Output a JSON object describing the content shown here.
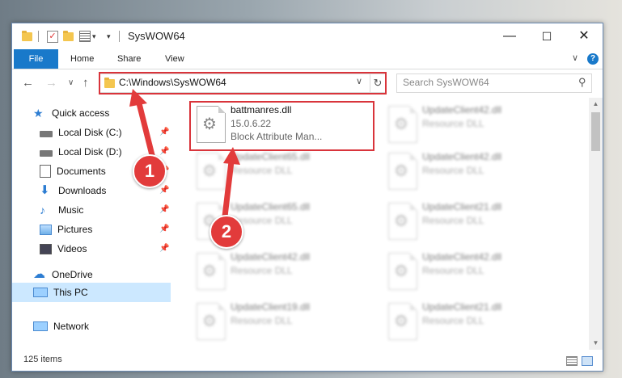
{
  "window": {
    "title": "SysWOW64",
    "minimize_glyph": "—",
    "maximize_glyph": "☐",
    "close_glyph": "✕"
  },
  "ribbon": {
    "tabs": [
      "File",
      "Home",
      "Share",
      "View"
    ],
    "expand_glyph": "∨",
    "help_glyph": "?"
  },
  "nav": {
    "back_glyph": "←",
    "forward_glyph": "→",
    "recent_glyph": "∨",
    "up_glyph": "↑",
    "address": "C:\\Windows\\SysWOW64",
    "address_dropdown_glyph": "∨",
    "refresh_glyph": "↻",
    "search_placeholder": "Search SysWOW64",
    "search_glyph": "⚲"
  },
  "sidebar": {
    "items": [
      {
        "label": "Quick access",
        "icon": "star-icon"
      },
      {
        "label": "Local Disk (C:)",
        "icon": "drive-icon"
      },
      {
        "label": "Local Disk (D:)",
        "icon": "drive-icon"
      },
      {
        "label": "Documents",
        "icon": "documents-icon"
      },
      {
        "label": "Downloads",
        "icon": "download-icon"
      },
      {
        "label": "Music",
        "icon": "music-icon"
      },
      {
        "label": "Pictures",
        "icon": "pictures-icon"
      },
      {
        "label": "Videos",
        "icon": "videos-icon"
      },
      {
        "label": "OneDrive",
        "icon": "cloud-icon"
      },
      {
        "label": "This PC",
        "icon": "computer-icon"
      },
      {
        "label": "Network",
        "icon": "network-icon"
      }
    ]
  },
  "files": [
    {
      "name": "battmanres.dll",
      "line2": "15.0.6.22",
      "line3": "Block Attribute Man..."
    },
    {
      "name": "UpdateClient42.dll",
      "line2": "Resource DLL"
    },
    {
      "name": "UpdateClient65.dll",
      "line2": "Resource DLL"
    },
    {
      "name": "UpdateClient42.dll",
      "line2": "Resource DLL"
    },
    {
      "name": "UpdateClient65.dll",
      "line2": "Resource DLL"
    },
    {
      "name": "UpdateClient21.dll",
      "line2": "Resource DLL"
    },
    {
      "name": "UpdateClient42.dll",
      "line2": "Resource DLL"
    },
    {
      "name": "UpdateClient42.dll",
      "line2": "Resource DLL"
    },
    {
      "name": "UpdateClient19.dll",
      "line2": "Resource DLL"
    },
    {
      "name": "UpdateClient21.dll",
      "line2": "Resource DLL"
    }
  ],
  "status": {
    "item_count": "125 items"
  },
  "annotations": {
    "step1": "1",
    "step2": "2",
    "color": "#e23b3b"
  }
}
